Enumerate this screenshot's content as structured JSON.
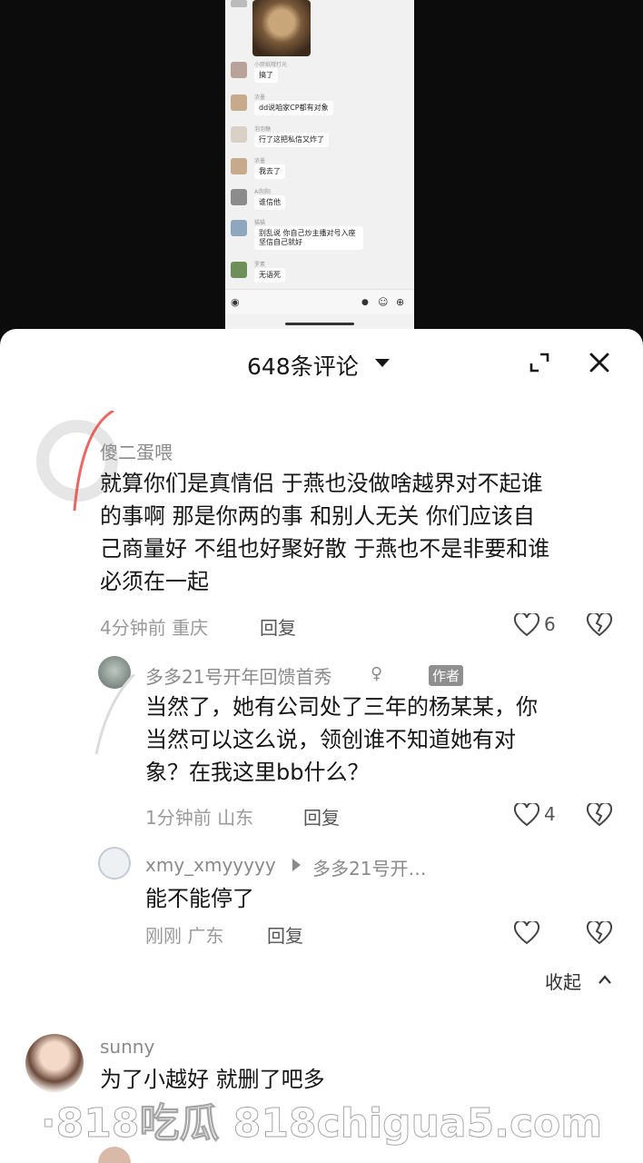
{
  "chat_screenshot": {
    "messages": [
      {
        "name": "小胖纸哦打光",
        "text": "搞了"
      },
      {
        "name": "浓墨",
        "text": "dd说咱家CP都有对象"
      },
      {
        "name": "泡泡糖",
        "text": "行了这把私信又炸了"
      },
      {
        "name": "浓墨",
        "text": "我去了"
      },
      {
        "name": "AI阳阳",
        "text": "谁信他"
      },
      {
        "name": "猫猫",
        "text": "别乱说 你自己炒主播对号入座 坚信自己就好"
      },
      {
        "name": "罗素",
        "text": "无语死"
      }
    ]
  },
  "header": {
    "comment_count_label": "648条评论"
  },
  "icons": {
    "dropdown": "caret-down-icon",
    "expand": "expand-icon",
    "close": "close-icon",
    "like": "heart-icon",
    "dislike": "broken-heart-icon",
    "collapse": "chevron-up-icon",
    "voice": "voice-icon",
    "emoji": "emoji-icon",
    "add": "plus-icon"
  },
  "comments": [
    {
      "user": "傻二蛋喂",
      "text_lines": [
        "就算你们是真情侣  于燕也没做啥越界对不起谁",
        "的事啊 那是你两的事 和别人无关 你们应该自",
        "己商量好 不组也好聚好散 于燕也不是非要和谁",
        "必须在一起"
      ],
      "time_location": "4分钟前 重庆",
      "reply_label": "回复",
      "likes": "6"
    },
    {
      "user": "多多21号开年回馈首秀",
      "author_tag": "作者",
      "text_lines": [
        "当然了，她有公司处了三年的杨某某，你",
        "当然可以这么说，领创谁不知道她有对",
        "象？在我这里bb什么？"
      ],
      "time_location": "1分钟前 山东",
      "reply_label": "回复",
      "likes": "4"
    },
    {
      "user": "xmy_xmyyyyy",
      "reply_to": "多多21号开…",
      "text_lines": [
        "能不能停了"
      ],
      "time_location": "刚刚 广东",
      "reply_label": "回复",
      "likes": ""
    },
    {
      "user": "sunny",
      "text_lines": [
        "为了小越好 就删了吧多"
      ],
      "time_location": "",
      "reply_label": "",
      "likes": ""
    }
  ],
  "collapse_label": "收起",
  "watermark_text": "·818吃瓜  818chigua5.com"
}
